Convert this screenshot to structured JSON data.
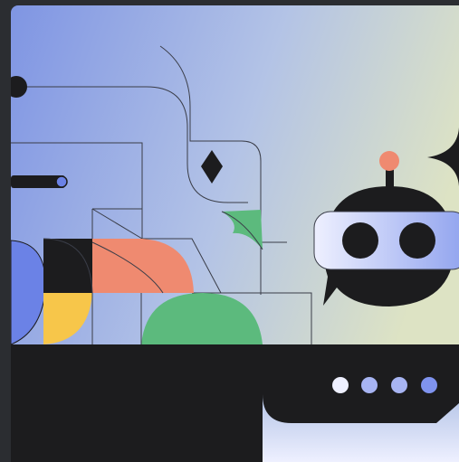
{
  "illustration": {
    "subject": "robot-chat-bot",
    "colors": {
      "page_bg": "#2b2d31",
      "gradient_start": "#7f95e3",
      "gradient_mid": "#b3c3e6",
      "gradient_end": "#dde3c4",
      "ink": "#1c1c1e",
      "line": "#3a3d48",
      "coral": "#ef8a70",
      "green": "#5cba7d",
      "yellow": "#f7c64a",
      "blue": "#6b82e6",
      "visor_light": "#eef0ff",
      "visor_blue": "#8fa2ee",
      "dot_white": "#eef0ff",
      "dot_blue": "#a7b4f2",
      "dot_accent": "#7f93ef"
    },
    "typing_indicator_dots": 4
  }
}
